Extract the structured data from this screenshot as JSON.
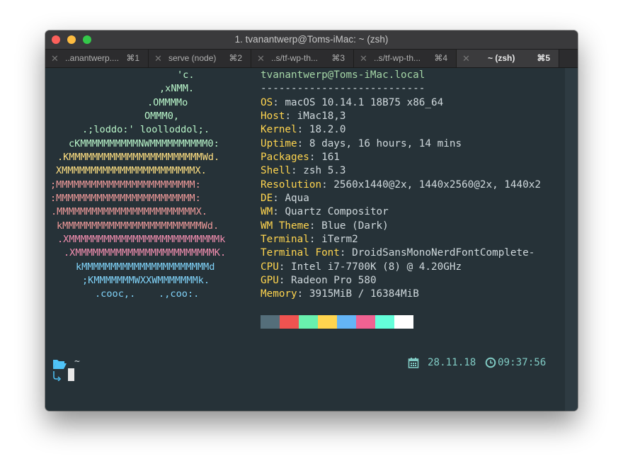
{
  "window": {
    "title": "1. tvanantwerp@Toms-iMac: ~ (zsh)",
    "traffic_lights": {
      "close": "#fc605b",
      "minimize": "#fdbc40",
      "zoom": "#34c84a"
    }
  },
  "tabs": [
    {
      "label": "..anantwerp....",
      "shortcut": "⌘1",
      "active": false
    },
    {
      "label": "serve (node)",
      "shortcut": "⌘2",
      "active": false
    },
    {
      "label": "..s/tf-wp-th...",
      "shortcut": "⌘3",
      "active": false
    },
    {
      "label": "..s/tf-wp-th...",
      "shortcut": "⌘4",
      "active": false
    },
    {
      "label": "~ (zsh)",
      "shortcut": "⌘5",
      "active": true
    }
  ],
  "logo": [
    {
      "text": "'c.",
      "color": "#b9f6ca"
    },
    {
      "text": ",xNMM.",
      "color": "#b9f6ca"
    },
    {
      "text": ".OMMMMo",
      "color": "#b9f6ca"
    },
    {
      "text": "OMMM0,",
      "color": "#b9f6ca"
    },
    {
      "text": ".;loddo:' loolloddol;.",
      "color": "#b9f6ca"
    },
    {
      "text": "cKMMMMMMMMMMNWMMMMMMMMMM0:",
      "color": "#b9f6ca"
    },
    {
      "text": ".KMMMMMMMMMMMMMMMMMMMMMMMWd.",
      "color": "#ffe082"
    },
    {
      "text": "XMMMMMMMMMMMMMMMMMMMMMMMX.",
      "color": "#ffe082"
    },
    {
      "text": ";MMMMMMMMMMMMMMMMMMMMMMMM:",
      "color": "#ef9a9a"
    },
    {
      "text": ":MMMMMMMMMMMMMMMMMMMMMMMM:",
      "color": "#ef9a9a"
    },
    {
      "text": ".MMMMMMMMMMMMMMMMMMMMMMMMX.",
      "color": "#ef9a9a"
    },
    {
      "text": "kMMMMMMMMMMMMMMMMMMMMMMMMWd.",
      "color": "#ef9a9a"
    },
    {
      "text": ".XMMMMMMMMMMMMMMMMMMMMMMMMMMk",
      "color": "#f48fb1"
    },
    {
      "text": ".XMMMMMMMMMMMMMMMMMMMMMMMMK.",
      "color": "#f48fb1"
    },
    {
      "text": "kMMMMMMMMMMMMMMMMMMMMMMd",
      "color": "#81d4fa"
    },
    {
      "text": ";KMMMMMMMWXXWMMMMMMMk.",
      "color": "#81d4fa"
    },
    {
      "text": ".cooc,.    .,coo:.",
      "color": "#81d4fa"
    }
  ],
  "sysinfo": {
    "header": "tvanantwerp@Toms-iMac.local",
    "divider": "---------------------------",
    "rows": [
      {
        "key": "OS",
        "value": "macOS 10.14.1 18B75 x86_64"
      },
      {
        "key": "Host",
        "value": "iMac18,3"
      },
      {
        "key": "Kernel",
        "value": "18.2.0"
      },
      {
        "key": "Uptime",
        "value": "8 days, 16 hours, 14 mins"
      },
      {
        "key": "Packages",
        "value": "161"
      },
      {
        "key": "Shell",
        "value": "zsh 5.3"
      },
      {
        "key": "Resolution",
        "value": "2560x1440@2x, 1440x2560@2x, 1440x2"
      },
      {
        "key": "DE",
        "value": "Aqua"
      },
      {
        "key": "WM",
        "value": "Quartz Compositor"
      },
      {
        "key": "WM Theme",
        "value": "Blue (Dark)"
      },
      {
        "key": "Terminal",
        "value": "iTerm2"
      },
      {
        "key": "Terminal Font",
        "value": "DroidSansMonoNerdFontComplete-"
      },
      {
        "key": "CPU",
        "value": "Intel i7-7700K (8) @ 4.20GHz"
      },
      {
        "key": "GPU",
        "value": "Radeon Pro 580"
      },
      {
        "key": "Memory",
        "value": "3915MiB / 16384MiB"
      }
    ],
    "separator": ": "
  },
  "palette": [
    "#546e7a",
    "#ef5350",
    "#69f0ae",
    "#ffd54f",
    "#64b5f6",
    "#f06292",
    "#64ffda",
    "#ffffff"
  ],
  "prompt": {
    "cwd": "~",
    "folder_icon": "folder-open-icon",
    "date": "28.11.18",
    "time": "09:37:56",
    "calendar_icon": "calendar-icon",
    "clock_icon": "clock-icon"
  },
  "colors": {
    "background": "#263238",
    "user_host": "#a5d6a7",
    "key": "#ffd54f",
    "value": "#cfd8dc",
    "prompt_accent": "#80cbc4",
    "folder": "#4fc3f7"
  }
}
